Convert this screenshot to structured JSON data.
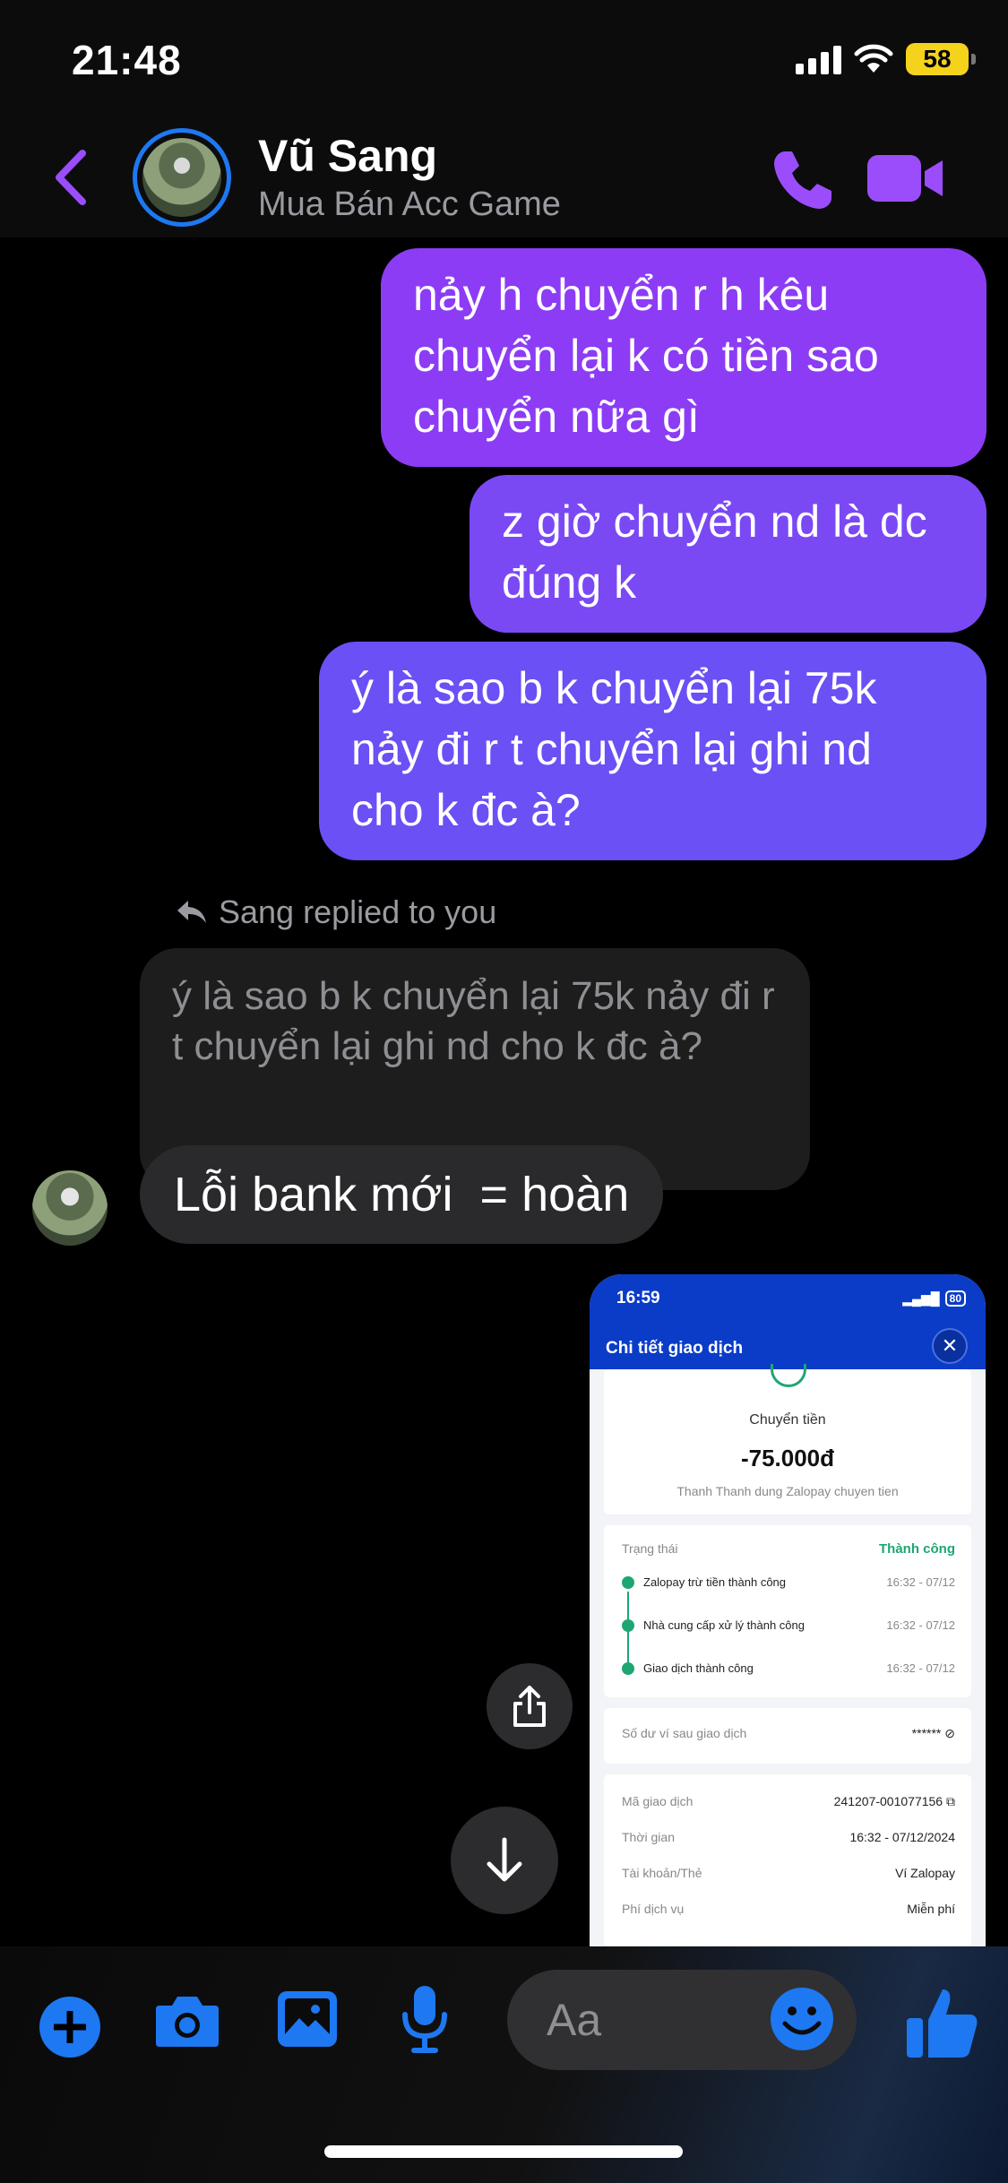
{
  "status_bar": {
    "time": "21:48",
    "battery": "58"
  },
  "header": {
    "contact_name": "Vũ Sang",
    "contact_subtitle": "Mua Bán Acc Game",
    "accent_color": "#9b4dfb"
  },
  "messages": {
    "outgoing": [
      "nảy h chuyển r h kêu chuyển lại k có tiền sao chuyển nữa gì",
      "z giờ chuyển nd là dc đúng k",
      "ý là sao b k chuyển lại 75k nảy đi r t chuyển lại ghi nd cho k đc à?"
    ],
    "reply_label": "Sang replied to you",
    "quoted_text": "ý là sao b k chuyển lại 75k nảy đi r t chuyển lại ghi nd cho k đc à?",
    "incoming_text": "Lỗi bank mới  = hoàn"
  },
  "attachment": {
    "time": "16:59",
    "battery": "80",
    "title": "Chi tiết giao dịch",
    "type_label": "Chuyển tiền",
    "amount": "-75.000đ",
    "note": "Thanh Thanh dung Zalopay chuyen tien",
    "status_label": "Trạng thái",
    "status_value": "Thành công",
    "steps": [
      {
        "label": "Zalopay trừ tiền thành công",
        "time": "16:32 - 07/12"
      },
      {
        "label": "Nhà cung cấp xử lý thành công",
        "time": "16:32 - 07/12"
      },
      {
        "label": "Giao dịch thành công",
        "time": "16:32 - 07/12"
      }
    ],
    "balance_label": "Số dư ví sau giao dịch",
    "balance_value": "******",
    "details": [
      {
        "label": "Mã giao dịch",
        "value": "241207-001077156"
      },
      {
        "label": "Thời gian",
        "value": "16:32 - 07/12/2024"
      },
      {
        "label": "Tài khoản/Thẻ",
        "value": "Ví Zalopay"
      },
      {
        "label": "Phí dịch vụ",
        "value": "Miễn phí"
      }
    ]
  },
  "composer": {
    "placeholder": "Aa",
    "icons": [
      "plus-icon",
      "camera-icon",
      "gallery-icon",
      "microphone-icon",
      "emoji-icon",
      "thumbs-up-icon"
    ],
    "accent_color": "#1d78f2"
  }
}
